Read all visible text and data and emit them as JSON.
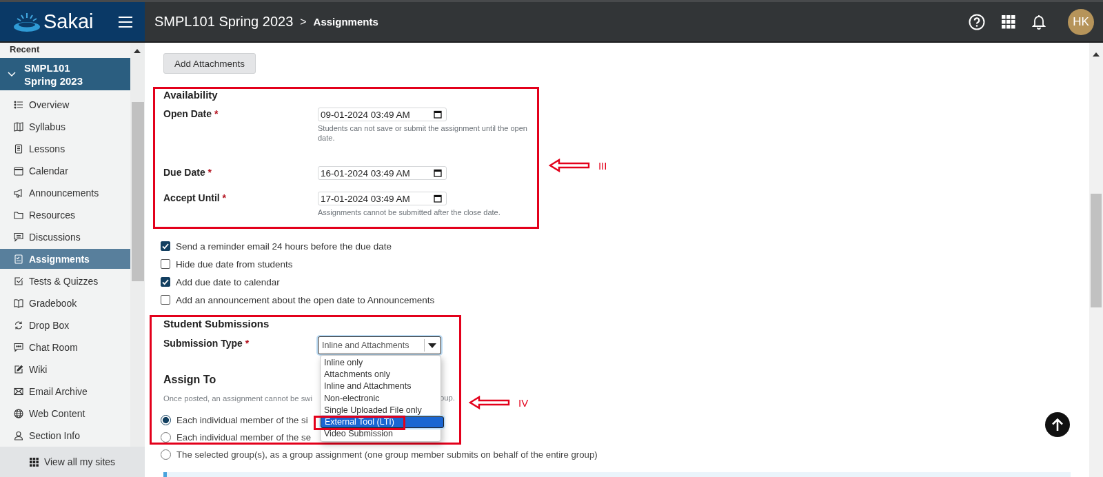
{
  "header": {
    "logo_text": "Sakai",
    "site_title": "SMPL101 Spring 2023",
    "breadcrumb_separator": ">",
    "page_title": "Assignments",
    "avatar_initials": "HK"
  },
  "sidebar": {
    "section_label": "Recent",
    "site": {
      "name": "SMPL101 Spring 2023",
      "expanded": true
    },
    "items": [
      {
        "label": "Overview",
        "kind": "list",
        "selected": false
      },
      {
        "label": "Syllabus",
        "kind": "map",
        "selected": false
      },
      {
        "label": "Lessons",
        "kind": "doc",
        "selected": false
      },
      {
        "label": "Calendar",
        "kind": "calendar",
        "selected": false
      },
      {
        "label": "Announcements",
        "kind": "megaphone",
        "selected": false
      },
      {
        "label": "Resources",
        "kind": "folder",
        "selected": false
      },
      {
        "label": "Discussions",
        "kind": "comment",
        "selected": false
      },
      {
        "label": "Assignments",
        "kind": "checklist",
        "selected": true
      },
      {
        "label": "Tests & Quizzes",
        "kind": "checkbox",
        "selected": false
      },
      {
        "label": "Gradebook",
        "kind": "book",
        "selected": false
      },
      {
        "label": "Drop Box",
        "kind": "sync",
        "selected": false
      },
      {
        "label": "Chat Room",
        "kind": "chat",
        "selected": false
      },
      {
        "label": "Wiki",
        "kind": "edit",
        "selected": false
      },
      {
        "label": "Email Archive",
        "kind": "mail",
        "selected": false
      },
      {
        "label": "Web Content",
        "kind": "globe",
        "selected": false
      },
      {
        "label": "Section Info",
        "kind": "person",
        "selected": false
      }
    ],
    "footer_link": "View all my sites"
  },
  "form": {
    "add_attachments_button": "Add Attachments",
    "availability": {
      "heading": "Availability",
      "fields": [
        {
          "label": "Open Date",
          "required_mark": "*",
          "value": "09-01-2024 03:49 AM",
          "help": "Students can not save or submit the assignment until the open date."
        },
        {
          "label": "Due Date",
          "required_mark": "*",
          "value": "16-01-2024 03:49 AM"
        },
        {
          "label": "Accept Until",
          "required_mark": "*",
          "value": "17-01-2024 03:49 AM",
          "help": "Assignments cannot be submitted after the close date."
        }
      ]
    },
    "options": [
      {
        "label": "Send a reminder email 24 hours before the due date",
        "checked": true
      },
      {
        "label": "Hide due date from students",
        "checked": false
      },
      {
        "label": "Add due date to calendar",
        "checked": true
      },
      {
        "label": "Add an announcement about the open date to Announcements",
        "checked": false
      }
    ],
    "submissions": {
      "heading": "Student Submissions",
      "type_label": "Submission Type",
      "required_mark": "*",
      "select_value": "Inline and Attachments",
      "dropdown_open": true,
      "choices": [
        {
          "label": "Inline only",
          "selected": false
        },
        {
          "label": "Attachments only",
          "selected": false
        },
        {
          "label": "Inline and Attachments",
          "selected": false
        },
        {
          "label": "Non-electronic",
          "selected": false
        },
        {
          "label": "Single Uploaded File only",
          "selected": false
        },
        {
          "label": "External Tool (LTI)",
          "selected": true
        },
        {
          "label": "Video Submission",
          "selected": false
        }
      ]
    },
    "assign_to": {
      "heading": "Assign To",
      "note_parts": [
        "Once posted, an assignment cannot be swi",
        "oup."
      ],
      "choices": [
        {
          "label": "Each individual member of the si",
          "selected": true
        },
        {
          "label": "Each individual member of the se",
          "selected": false
        },
        {
          "label": "The selected group(s), as a group assignment (one group member submits on behalf of the entire group)",
          "selected": false
        }
      ]
    }
  },
  "annotations": [
    {
      "label": "III"
    },
    {
      "label": "IV"
    }
  ]
}
